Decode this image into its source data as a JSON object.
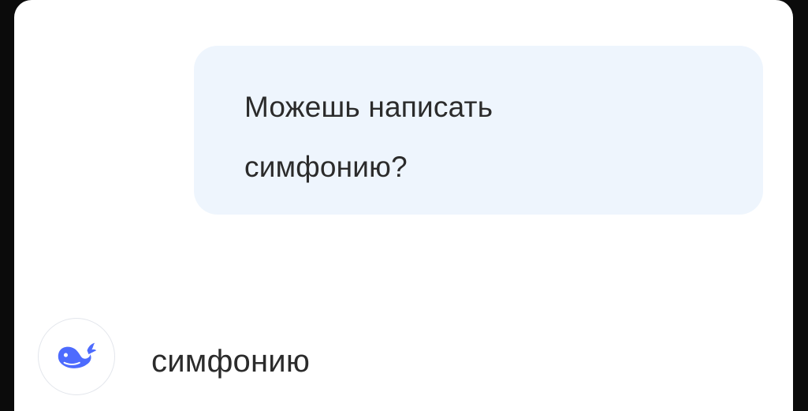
{
  "conversation": {
    "user_message": {
      "line1": "Можешь написать",
      "line2": "симфонию?"
    },
    "assistant_message": {
      "avatar_icon": "whale-logo-icon",
      "text": "симфонию"
    }
  },
  "colors": {
    "user_bubble_bg": "#eef5fd",
    "brand_blue": "#4d6bfe",
    "text": "#2b2b2b"
  }
}
